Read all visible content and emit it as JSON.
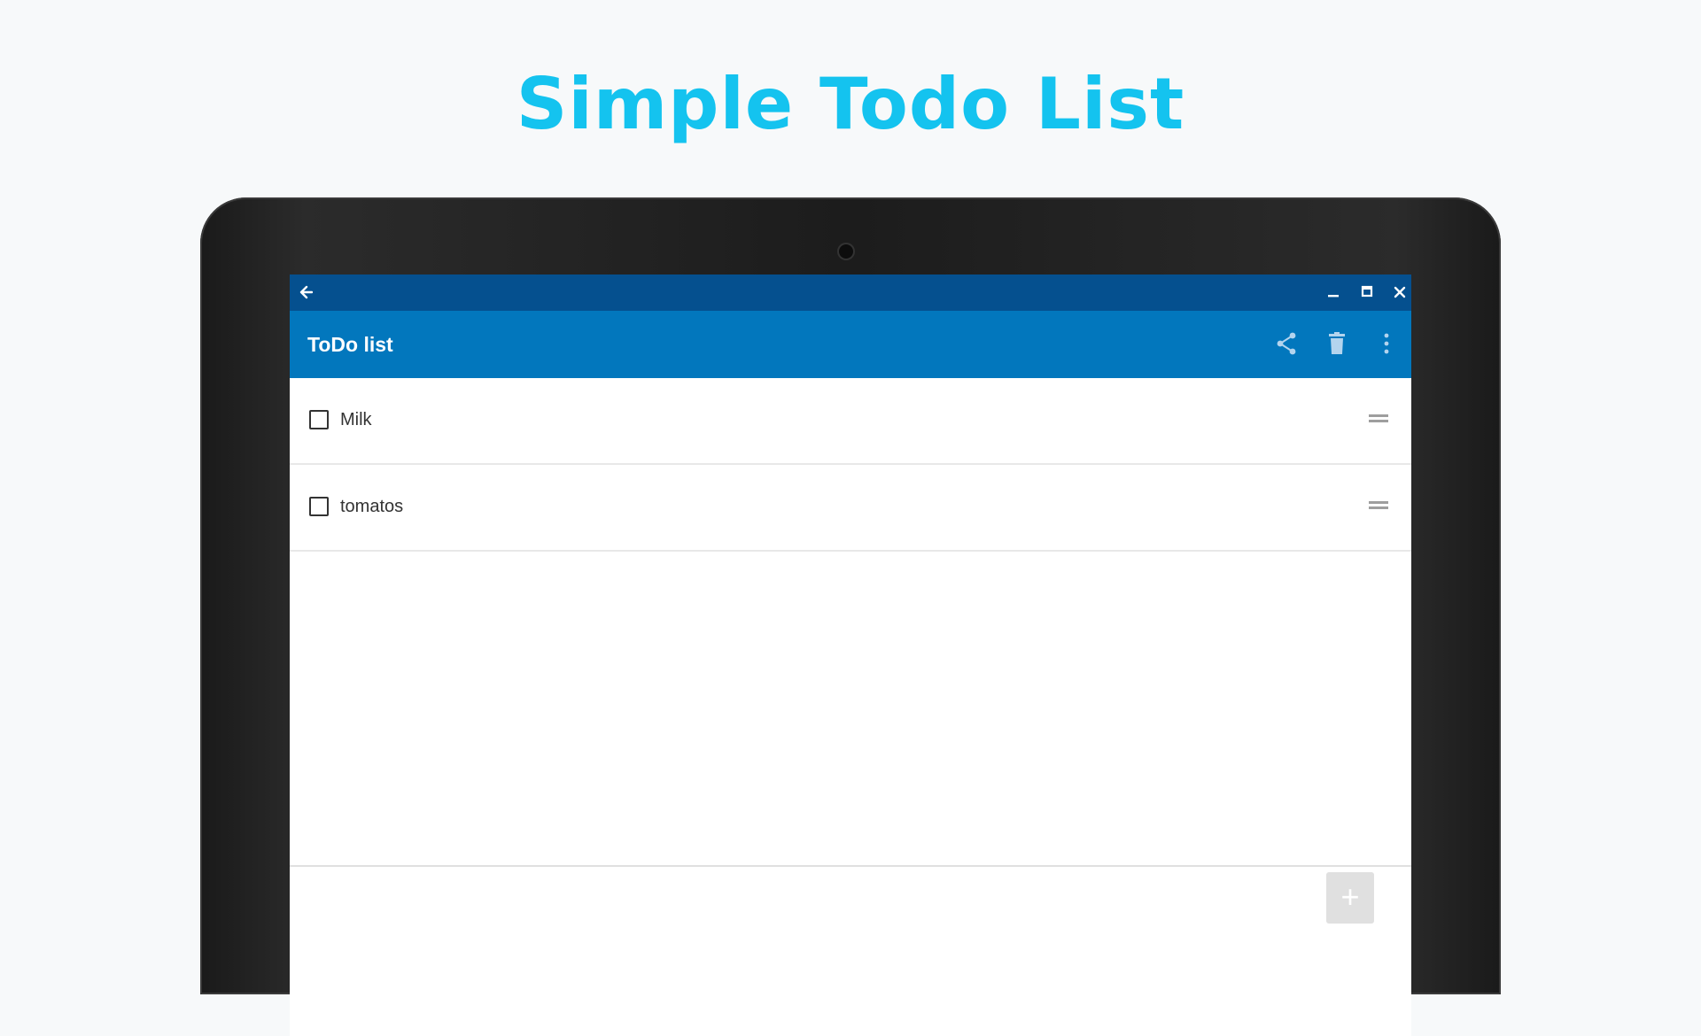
{
  "headline": "Simple Todo List",
  "window": {
    "back_icon": "arrow-left-icon",
    "minimize_glyph": "–",
    "maximize_glyph": "◰",
    "close_glyph": "✕"
  },
  "appbar": {
    "title": "ToDo list",
    "actions": [
      "share-icon",
      "trash-icon",
      "more-vert-icon"
    ]
  },
  "todos": [
    {
      "label": "Milk",
      "checked": false
    },
    {
      "label": "tomatos",
      "checked": false
    }
  ],
  "fab": {
    "glyph": "+"
  },
  "colors": {
    "headline": "#14c3ef",
    "titlebar": "#05508f",
    "appbar": "#0277bd"
  }
}
